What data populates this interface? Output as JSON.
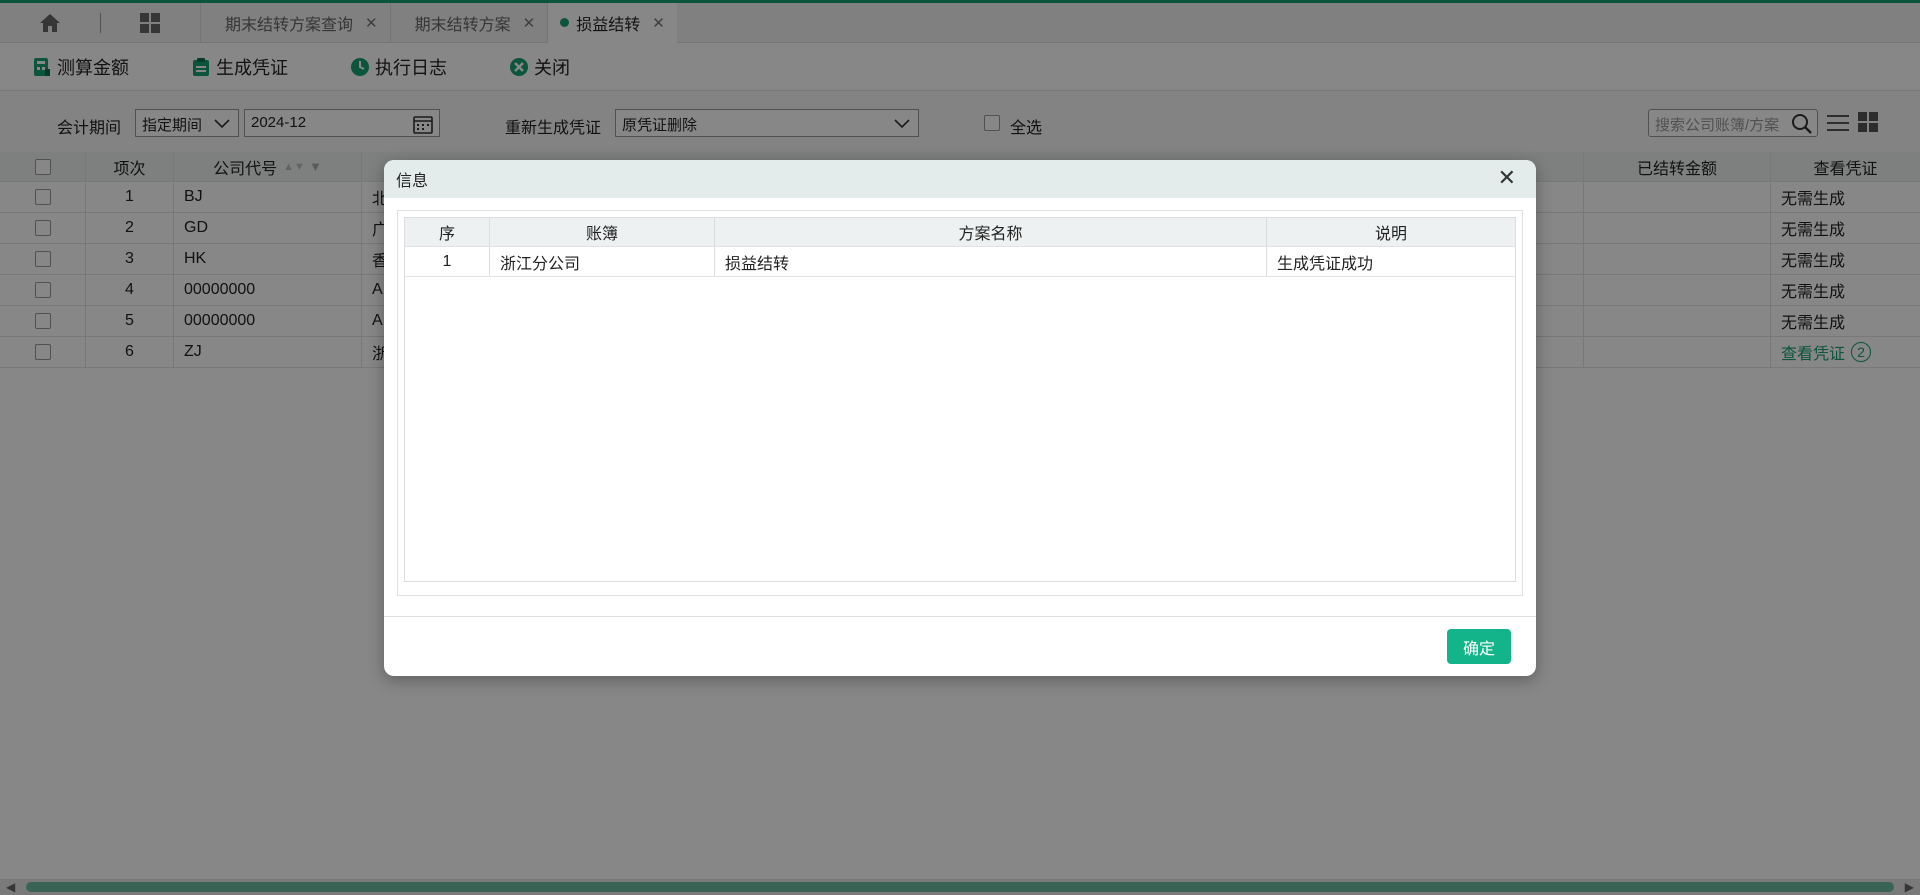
{
  "tabs": [
    {
      "label": "期末结转方案查询"
    },
    {
      "label": "期末结转方案"
    },
    {
      "label": "损益结转"
    }
  ],
  "toolbar": {
    "calc_label": "测算金额",
    "generate_label": "生成凭证",
    "log_label": "执行日志",
    "close_label": "关闭"
  },
  "filters": {
    "period_label": "会计期间",
    "period_mode": "指定期间",
    "period_value": "2024-12",
    "regen_label": "重新生成凭证",
    "regen_value": "原凭证删除",
    "select_all_label": "全选",
    "search_placeholder": "搜索公司账簿/方案"
  },
  "grid": {
    "headers": {
      "index": "项次",
      "company_code": "公司代号",
      "carried_amount": "已结转金额",
      "view_voucher": "查看凭证"
    },
    "rows": [
      {
        "index": "1",
        "code": "BJ",
        "name_prefix": "北",
        "voucher": "无需生成"
      },
      {
        "index": "2",
        "code": "GD",
        "name_prefix": "广",
        "voucher": "无需生成"
      },
      {
        "index": "3",
        "code": "HK",
        "name_prefix": "香",
        "voucher": "无需生成"
      },
      {
        "index": "4",
        "code": "00000000",
        "name_prefix": "A",
        "voucher": "无需生成"
      },
      {
        "index": "5",
        "code": "00000000",
        "name_prefix": "A",
        "voucher": "无需生成"
      },
      {
        "index": "6",
        "code": "ZJ",
        "name_prefix": "浙",
        "voucher": "查看凭证",
        "badge": "2"
      }
    ]
  },
  "dialog": {
    "title": "信息",
    "headers": {
      "seq": "序",
      "ledger": "账簿",
      "plan": "方案名称",
      "desc": "说明"
    },
    "rows": [
      {
        "seq": "1",
        "ledger": "浙江分公司",
        "plan": "损益结转",
        "desc": "生成凭证成功"
      }
    ],
    "ok_label": "确定"
  },
  "colors": {
    "accent": "#1a9f72",
    "button": "#14b48a"
  }
}
